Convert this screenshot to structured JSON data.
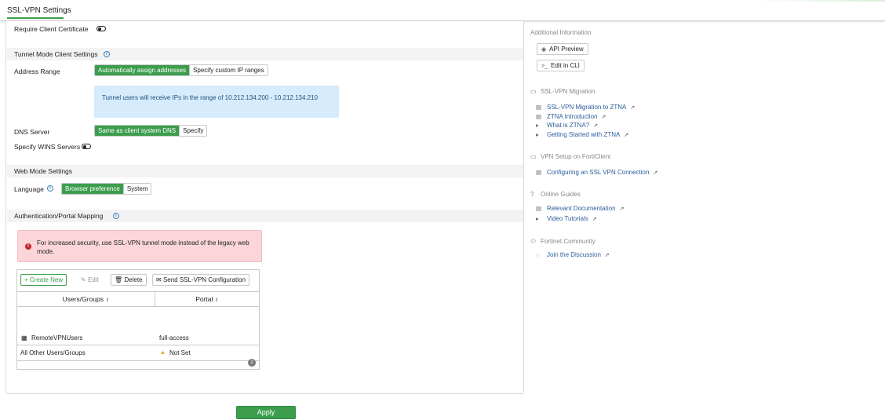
{
  "header": {
    "title": "SSL-VPN Settings"
  },
  "form": {
    "require_client_certificate": {
      "label": "Require Client Certificate",
      "enabled": false
    },
    "tunnel_section": {
      "title": "Tunnel Mode Client Settings"
    },
    "address_range": {
      "label": "Address Range",
      "options": [
        "Automatically assign addresses",
        "Specify custom IP ranges"
      ],
      "selected": "Automatically assign addresses",
      "info": "Tunnel users will receive IPs in the range of 10.212.134.200 - 10.212.134.210"
    },
    "dns_server": {
      "label": "DNS Server",
      "options": [
        "Same as client system DNS",
        "Specify"
      ],
      "selected": "Same as client system DNS"
    },
    "wins_servers": {
      "label": "Specify WINS Servers",
      "enabled": false
    },
    "web_section": {
      "title": "Web Mode Settings"
    },
    "language": {
      "label": "Language",
      "options": [
        "Browser preference",
        "System"
      ],
      "selected": "Browser preference"
    },
    "auth_section": {
      "title": "Authentication/Portal Mapping"
    },
    "alert": "For increased security, use SSL-VPN tunnel mode instead of the legacy web mode.",
    "table": {
      "toolbar": {
        "create_new": "+ Create New",
        "edit": "Edit",
        "delete": "Delete",
        "send": "Send SSL-VPN Configuration"
      },
      "columns": [
        "Users/Groups",
        "Portal"
      ],
      "rows": [
        {
          "user": "RemoteVPNUsers",
          "portal": "full-access"
        },
        {
          "user": "All Other Users/Groups",
          "portal": "Not Set"
        }
      ],
      "count": "2"
    }
  },
  "apply_label": "Apply",
  "sidebar": {
    "additional_info": {
      "title": "Additional Information",
      "buttons": [
        "API Preview",
        "Edit in CLI"
      ]
    },
    "migration": {
      "title": "SSL-VPN Migration",
      "links": [
        "SSL-VPN Migration to ZTNA",
        "ZTNA Introduction",
        "What is ZTNA?",
        "Getting Started with ZTNA"
      ]
    },
    "vpn_setup": {
      "title": "VPN Setup on FortiClient",
      "links": [
        "Configuring an SSL VPN Connection"
      ]
    },
    "online_guides": {
      "title": "Online Guides",
      "links": [
        "Relevant Documentation",
        "Video Tutorials"
      ]
    },
    "community": {
      "title": "Fortinet Community",
      "links": [
        "Join the Discussion"
      ]
    }
  },
  "colors": {
    "accent": "#3c9d4d",
    "info_bg": "#d6ebfb",
    "alert_bg": "#fbd5da",
    "link": "#2b5d9a"
  }
}
